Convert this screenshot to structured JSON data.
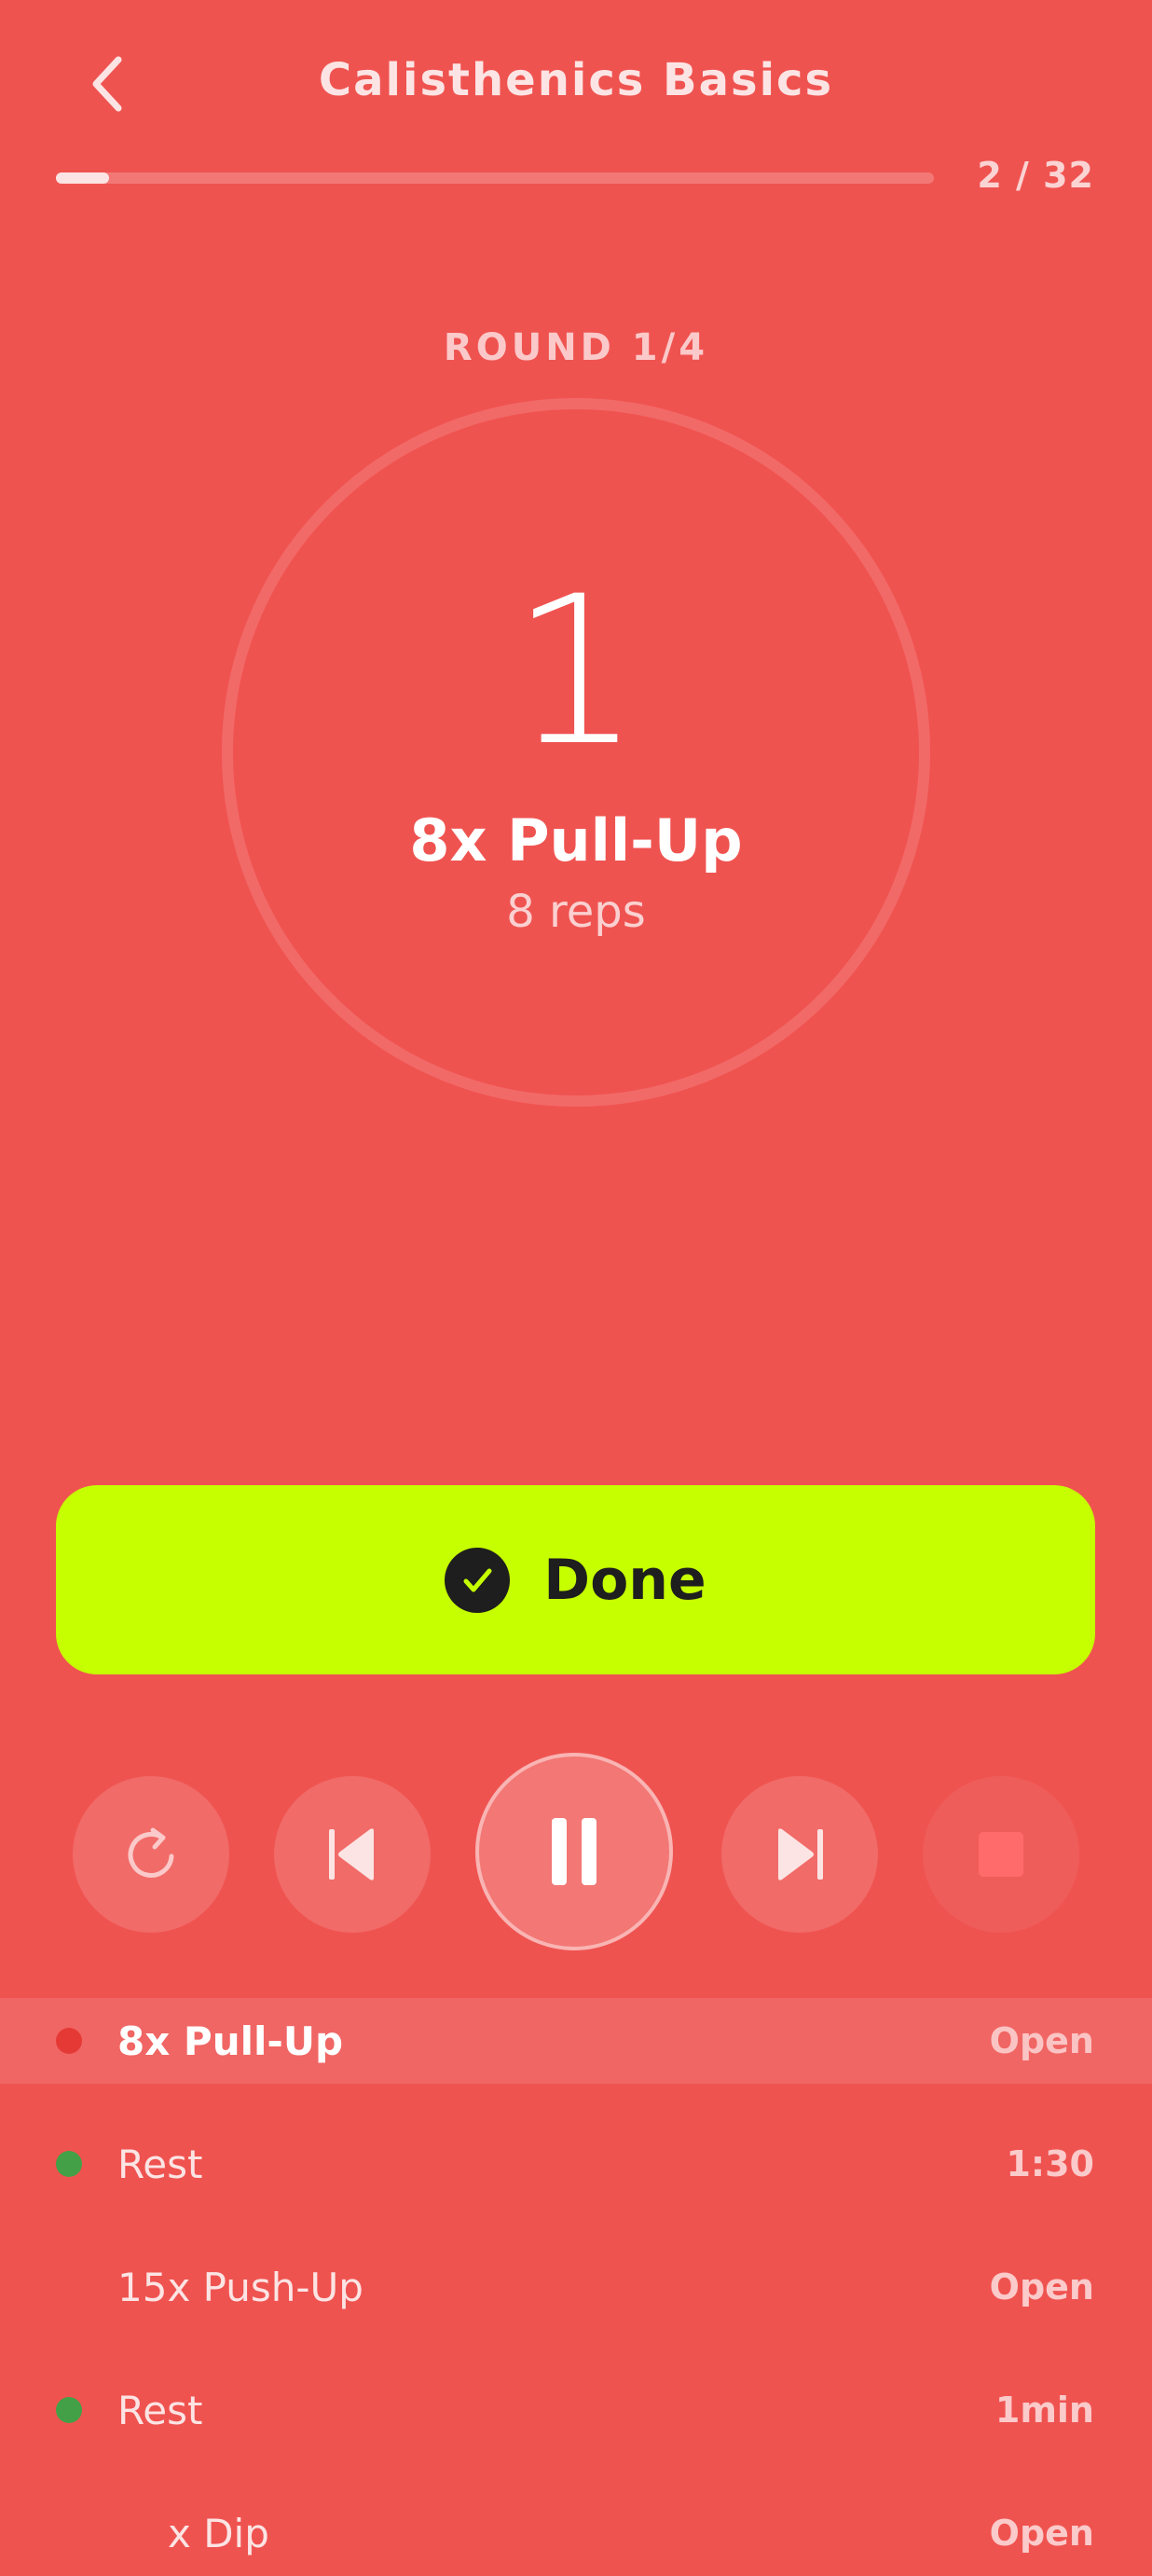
{
  "header": {
    "title": "Calisthenics Basics",
    "back_icon": "chevron-left-icon",
    "progress_text": "2 / 32",
    "progress_fraction": 0.0625
  },
  "timer": {
    "round_label": "ROUND 1/4",
    "count": "1",
    "exercise_name": "8x Pull-Up",
    "exercise_detail": "8 reps"
  },
  "done_button": {
    "label": "Done",
    "icon": "check-circle-icon",
    "color": "#C6FF00"
  },
  "controls": {
    "restart_icon": "restart-icon",
    "previous_icon": "skip-previous-icon",
    "pause_icon": "pause-icon",
    "next_icon": "skip-next-icon",
    "stop_icon": "stop-icon"
  },
  "list": [
    {
      "name": "8x Pull-Up",
      "value": "Open",
      "dot_color": "#E53935",
      "active": true
    },
    {
      "name": "Rest",
      "value": "1:30",
      "dot_color": "#43A047",
      "active": false
    },
    {
      "name": "15x Push-Up",
      "value": "Open",
      "dot_color": "",
      "active": false
    },
    {
      "name": "Rest",
      "value": "1min",
      "dot_color": "#43A047",
      "active": false
    },
    {
      "name": "x Dip",
      "value": "Open",
      "dot_color": "",
      "active": false
    }
  ],
  "colors": {
    "background": "#EF5350",
    "accent": "#C6FF00",
    "rest_dot": "#43A047",
    "exercise_dot": "#E53935"
  }
}
